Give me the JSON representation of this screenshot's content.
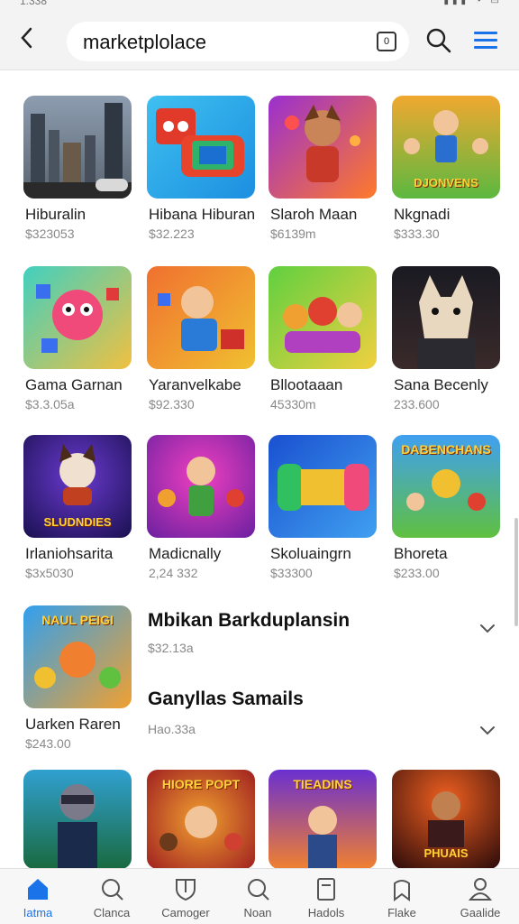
{
  "status_bar": {
    "time": "1:338"
  },
  "search": {
    "query": "marketplolace"
  },
  "grid": [
    {
      "name": "Hiburalin",
      "price": "$323053"
    },
    {
      "name": "Hibana Hiburan",
      "price": "$32.223"
    },
    {
      "name": "Slaroh Maan",
      "price": "$6139m"
    },
    {
      "name": "Nkgnadi",
      "price": "$333.30"
    },
    {
      "name": "Gama Garnan",
      "price": "$3.3.05a"
    },
    {
      "name": "Yaranvelkabe",
      "price": "$92.330"
    },
    {
      "name": "Bllootaaan",
      "price": "45330m"
    },
    {
      "name": "Sana Becenly",
      "price": "233.600"
    },
    {
      "name": "Irlaniohsarita",
      "price": "$3x5030"
    },
    {
      "name": "Madicnally",
      "price": "2,24 332"
    },
    {
      "name": "Skoluaingrn",
      "price": "$33300"
    },
    {
      "name": "Bhoreta",
      "price": "$233.00"
    },
    {
      "name": "Uarken Raren",
      "price": "$243.00"
    }
  ],
  "thumb_text": {
    "tile4": "DJONVENS",
    "tile9": "SLUDNDIES",
    "tile12": "DABENCHANS",
    "tile13": "NAUL PEIGI",
    "row5_2": "HIORE POPT",
    "row5_3": "TIEADINS",
    "row5_4": "PHUAIS"
  },
  "sections": [
    {
      "title": "Mbikan Barkduplansin",
      "sub": "$32.13a"
    },
    {
      "title": "Ganyllas Samails",
      "sub": "Hao.33a"
    }
  ],
  "bottom_nav": [
    {
      "label": "Iatma",
      "icon": "home-icon",
      "active": true
    },
    {
      "label": "Clanca",
      "icon": "search-icon",
      "active": false
    },
    {
      "label": "Camoger",
      "icon": "shield-icon",
      "active": false
    },
    {
      "label": "Noan",
      "icon": "search-icon",
      "active": false
    },
    {
      "label": "Hadols",
      "icon": "document-icon",
      "active": false
    },
    {
      "label": "Flake",
      "icon": "bookmark-icon",
      "active": false
    },
    {
      "label": "Gaalide",
      "icon": "person-icon",
      "active": false
    }
  ],
  "colors": {
    "accent": "#1a73e8",
    "bar_bg": "#f3f3f3"
  }
}
